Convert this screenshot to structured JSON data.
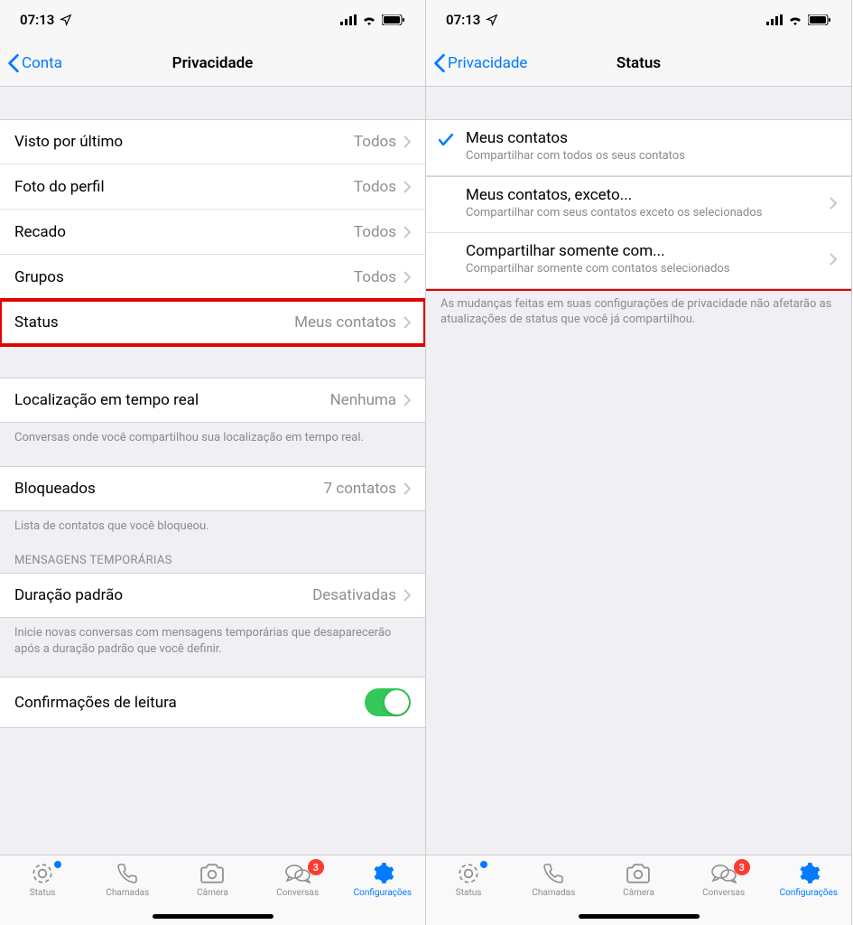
{
  "statusbar": {
    "time": "07:13"
  },
  "left": {
    "nav": {
      "back": "Conta",
      "title": "Privacidade"
    },
    "rows": {
      "lastseen": {
        "label": "Visto por último",
        "value": "Todos"
      },
      "photo": {
        "label": "Foto do perfil",
        "value": "Todos"
      },
      "about": {
        "label": "Recado",
        "value": "Todos"
      },
      "groups": {
        "label": "Grupos",
        "value": "Todos"
      },
      "status": {
        "label": "Status",
        "value": "Meus contatos"
      },
      "liveloc": {
        "label": "Localização em tempo real",
        "value": "Nenhuma"
      },
      "blocked": {
        "label": "Bloqueados",
        "value": "7 contatos"
      },
      "duration": {
        "label": "Duração padrão",
        "value": "Desativadas"
      },
      "readrec": {
        "label": "Confirmações de leitura"
      }
    },
    "footers": {
      "liveloc": "Conversas onde você compartilhou sua localização em tempo real.",
      "blocked": "Lista de contatos que você bloqueou.",
      "temp_header": "MENSAGENS TEMPORÁRIAS",
      "duration": "Inicie novas conversas com mensagens temporárias que desaparecerão após a duração padrão que você definir."
    }
  },
  "right": {
    "nav": {
      "back": "Privacidade",
      "title": "Status"
    },
    "options": {
      "contacts": {
        "title": "Meus contatos",
        "sub": "Compartilhar com todos os seus contatos"
      },
      "except": {
        "title": "Meus contatos, exceto...",
        "sub": "Compartilhar com seus contatos exceto os selecionados"
      },
      "only": {
        "title": "Compartilhar somente com...",
        "sub": "Compartilhar somente com contatos selecionados"
      }
    },
    "footer": "As mudanças feitas em suas configurações de privacidade não afetarão as atualizações de status que você já compartilhou."
  },
  "tabs": {
    "status": "Status",
    "calls": "Chamadas",
    "camera": "Câmera",
    "chats": "Conversas",
    "settings": "Configurações",
    "badge": "3"
  }
}
